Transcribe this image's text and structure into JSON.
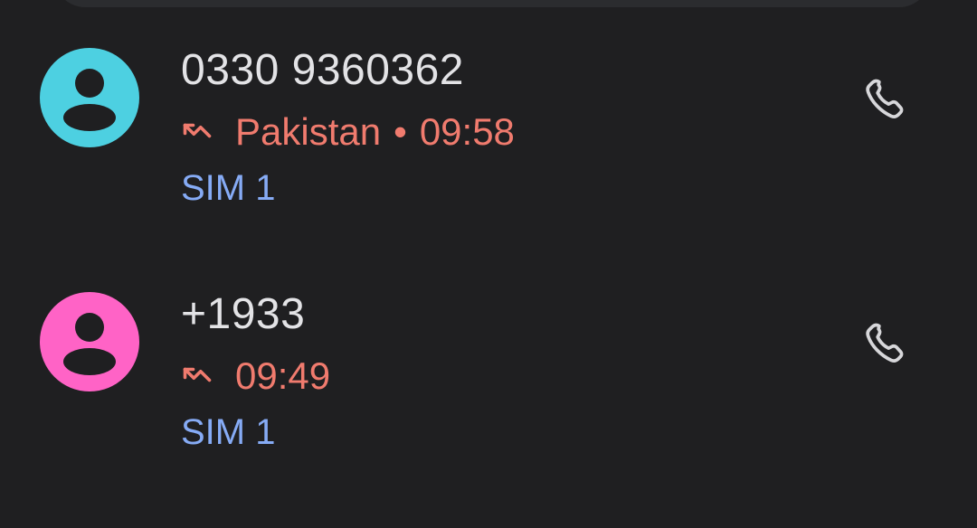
{
  "calls": [
    {
      "number": "0330 9360362",
      "location": "Pakistan",
      "separator": "•",
      "time": "09:58",
      "sim": "SIM 1",
      "avatar_color": "#4dd0e1",
      "call_type_icon": "missed-call-icon",
      "action_icon": "phone-icon"
    },
    {
      "number": "+1933",
      "time": "09:49",
      "sim": "SIM 1",
      "avatar_color": "#ff63c6",
      "call_type_icon": "missed-call-icon",
      "action_icon": "phone-icon"
    }
  ],
  "colors": {
    "background": "#1f1f21",
    "title": "#e3e3e6",
    "missed": "#f07b6e",
    "sim": "#86abf5",
    "icon": "#d7d7da"
  }
}
